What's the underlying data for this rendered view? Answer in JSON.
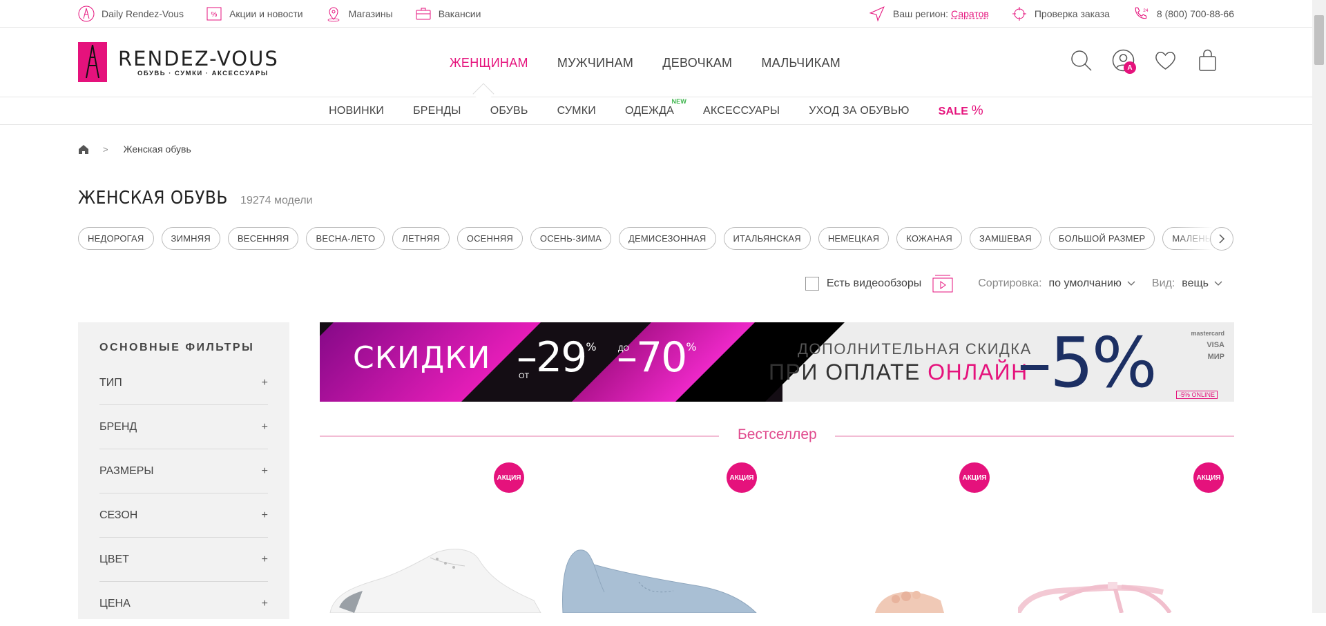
{
  "topbar": {
    "left": [
      {
        "label": "Daily Rendez-Vous",
        "icon": "eiffel-tower-icon"
      },
      {
        "label": "Акции и новости",
        "icon": "discount-tag-icon"
      },
      {
        "label": "Магазины",
        "icon": "map-pin-icon"
      },
      {
        "label": "Вакансии",
        "icon": "briefcase-icon"
      }
    ],
    "region_label": "Ваш регион:",
    "region_value": "Саратов",
    "order_check": "Проверка заказа",
    "phone": "8 (800) 700-88-66"
  },
  "logo": {
    "name": "RENDEZ-VOUS",
    "tagline": "ОБУВЬ · СУМКИ · АКСЕССУАРЫ",
    "brand_color": "#e5127c"
  },
  "gender_nav": [
    "ЖЕНЩИНАМ",
    "МУЖЧИНАМ",
    "ДЕВОЧКАМ",
    "МАЛЬЧИКАМ"
  ],
  "header_icons": {
    "account_badge": "A"
  },
  "category_nav": {
    "items": [
      "НОВИНКИ",
      "БРЕНДЫ",
      "ОБУВЬ",
      "СУМКИ",
      "ОДЕЖДА",
      "АКСЕССУАРЫ",
      "УХОД ЗА ОБУВЬЮ"
    ],
    "new_badge": "NEW",
    "sale_label": "SALE",
    "sale_pct": "%"
  },
  "breadcrumb": {
    "sep": ">",
    "current": "Женская обувь"
  },
  "page": {
    "title": "ЖЕНСКАЯ ОБУВЬ",
    "count": "19274 модели"
  },
  "chips": [
    "НЕДОРОГАЯ",
    "ЗИМНЯЯ",
    "ВЕСЕННЯЯ",
    "ВЕСНА-ЛЕТО",
    "ЛЕТНЯЯ",
    "ОСЕННЯЯ",
    "ОСЕНЬ-ЗИМА",
    "ДЕМИСЕЗОННАЯ",
    "ИТАЛЬЯНСКАЯ",
    "НЕМЕЦКАЯ",
    "КОЖАНАЯ",
    "ЗАМШЕВАЯ",
    "БОЛЬШОЙ РАЗМЕР",
    "МАЛЕНЬКИЙ"
  ],
  "tools": {
    "video_label": "Есть видеообзоры",
    "sort_label": "Сортировка:",
    "sort_value": "по умолчанию",
    "view_label": "Вид:",
    "view_value": "вещь"
  },
  "filters": {
    "title": "ОСНОВНЫЕ ФИЛЬТРЫ",
    "plus": "+",
    "items": [
      "ТИП",
      "БРЕНД",
      "РАЗМЕРЫ",
      "СЕЗОН",
      "ЦВЕТ",
      "ЦЕНА"
    ]
  },
  "banner": {
    "skidki": "СКИДКИ",
    "ot": "ОТ",
    "val1": "–29",
    "do": "ДО",
    "val2": "–70",
    "pct": "%",
    "line1": "ДОПОЛНИТЕЛЬНАЯ СКИДКА",
    "line2a": "ПРИ ОПЛАТЕ ",
    "line2b": "ОНЛАЙН",
    "big": "–5%",
    "pay1": "mastercard",
    "pay2": "VISA",
    "pay3": "МИР",
    "online_tag": "-5% ONLINE"
  },
  "section": {
    "title": "Бестселлер"
  },
  "products": [
    {
      "badge": "АКЦИЯ"
    },
    {
      "badge": "АКЦИЯ"
    },
    {
      "badge": "АКЦИЯ"
    },
    {
      "badge": "АКЦИЯ"
    }
  ]
}
